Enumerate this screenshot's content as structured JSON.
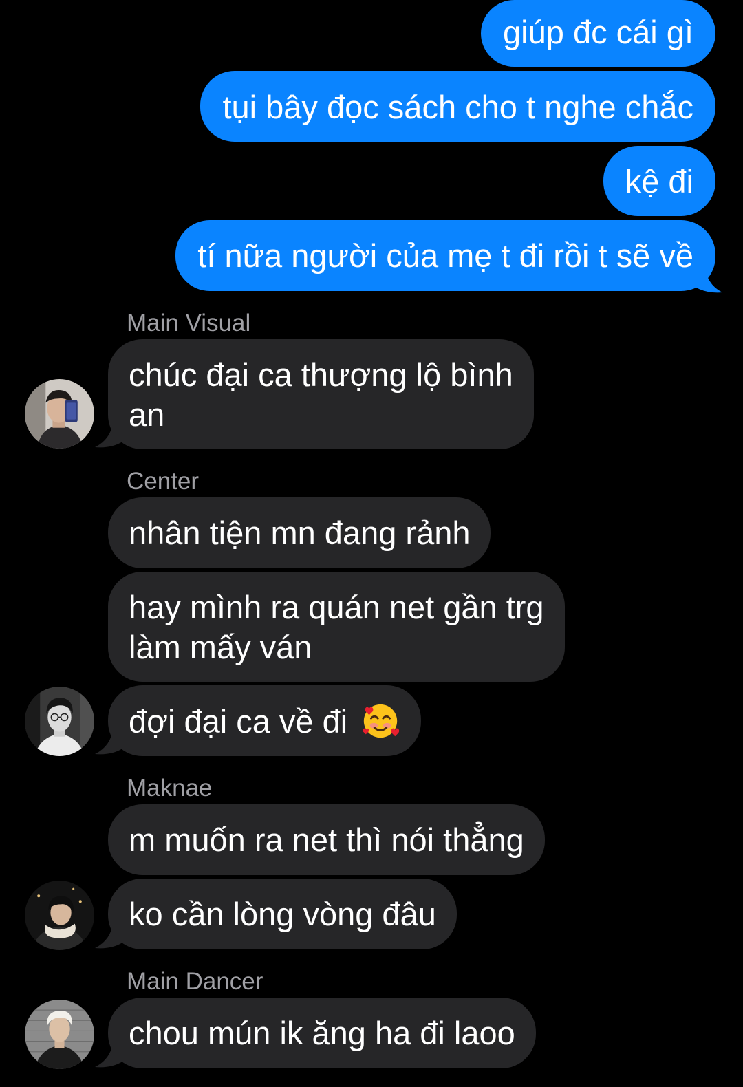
{
  "outgoing": [
    {
      "text": "giúp đc cái gì"
    },
    {
      "text": "tụi bây đọc sách cho t nghe chắc"
    },
    {
      "text": "kệ đi"
    },
    {
      "text": "tí nữa người của mẹ t đi rồi t sẽ về"
    }
  ],
  "groups": [
    {
      "sender": "Main Visual",
      "messages": [
        {
          "line1": "chúc đại ca thượng lộ bình",
          "line2": "an"
        }
      ]
    },
    {
      "sender": "Center",
      "messages": [
        {
          "text": "nhân tiện mn đang rảnh"
        },
        {
          "line1": "hay mình ra quán net gần trg",
          "line2": "làm mấy ván"
        },
        {
          "text": "đợi đại ca về đi",
          "emoji": "smiling-face-with-hearts"
        }
      ]
    },
    {
      "sender": "Maknae",
      "messages": [
        {
          "text": "m muốn ra net thì nói thẳng"
        },
        {
          "text": "ko cần lòng vòng đâu"
        }
      ]
    },
    {
      "sender": "Main Dancer",
      "messages": [
        {
          "text": "chou mún ik ăng ha đi laoo"
        }
      ]
    }
  ],
  "colors": {
    "background": "#000000",
    "outgoing_bubble": "#0a84ff",
    "incoming_bubble": "#262628",
    "sender_name": "#a0a0a5",
    "message_text": "#ffffff"
  }
}
